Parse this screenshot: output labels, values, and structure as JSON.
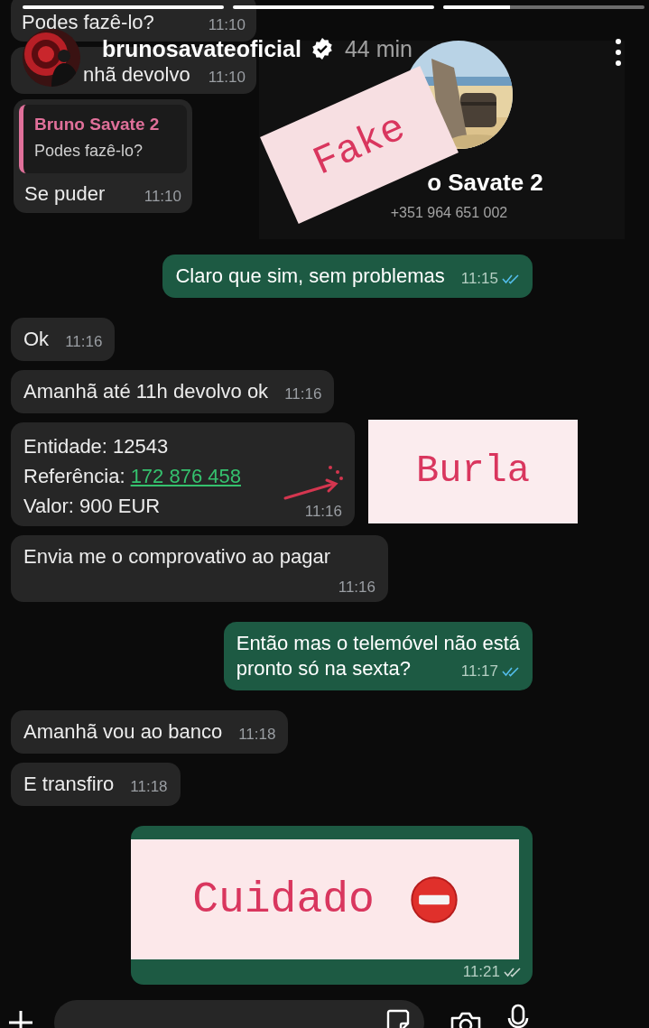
{
  "story": {
    "progress": [
      {
        "level": 1
      },
      {
        "level": 1
      },
      {
        "level": 0.33
      }
    ],
    "username": "brunosavateoficial",
    "verified": true,
    "time": "44 min"
  },
  "chat": {
    "top_messages": [
      {
        "kind": "text",
        "text": "Podes fazê-lo?",
        "time": "11:10"
      },
      {
        "kind": "text",
        "text": "nhã devolvo",
        "time": "11:10"
      },
      {
        "kind": "reply",
        "quote_author": "Bruno Savate 2",
        "quote_text": "Podes fazê-lo?",
        "text": "Se puder",
        "time": "11:10"
      }
    ],
    "contact": {
      "name": "o Savate 2",
      "phone": "+351 964 651 002"
    },
    "messages": [
      {
        "outgoing": true,
        "kind": "text",
        "lines": [
          "Claro que sim, sem problemas"
        ],
        "time": "11:15",
        "read": true
      },
      {
        "outgoing": false,
        "kind": "text",
        "lines": [
          "Ok"
        ],
        "time": "11:16"
      },
      {
        "outgoing": false,
        "kind": "text",
        "lines": [
          "Amanhã até 11h devolvo ok"
        ],
        "time": "11:16"
      },
      {
        "outgoing": false,
        "kind": "payment",
        "entity": "Entidade: 12543",
        "reference_label": "Referência:",
        "reference": "172 876 458",
        "amount": "Valor: 900 EUR",
        "time": "11:16"
      },
      {
        "outgoing": false,
        "kind": "block",
        "text": "Envia me o comprovativo ao pagar",
        "time": "11:16"
      },
      {
        "outgoing": true,
        "kind": "text",
        "lines": [
          "Então mas o telemóvel não está",
          "pronto só na sexta?"
        ],
        "time": "11:17",
        "read": true
      },
      {
        "outgoing": false,
        "kind": "text",
        "lines": [
          "Amanhã vou ao banco"
        ],
        "time": "11:18"
      },
      {
        "outgoing": false,
        "kind": "text",
        "lines": [
          "E transfiro"
        ],
        "time": "11:18"
      },
      {
        "outgoing": true,
        "kind": "covered",
        "time": "11:21",
        "read": false
      }
    ]
  },
  "stickers": [
    {
      "kind": "fake",
      "text": "Fake"
    },
    {
      "kind": "burla",
      "text": "Burla"
    },
    {
      "kind": "cuidado",
      "text": "Cuidado"
    }
  ]
}
